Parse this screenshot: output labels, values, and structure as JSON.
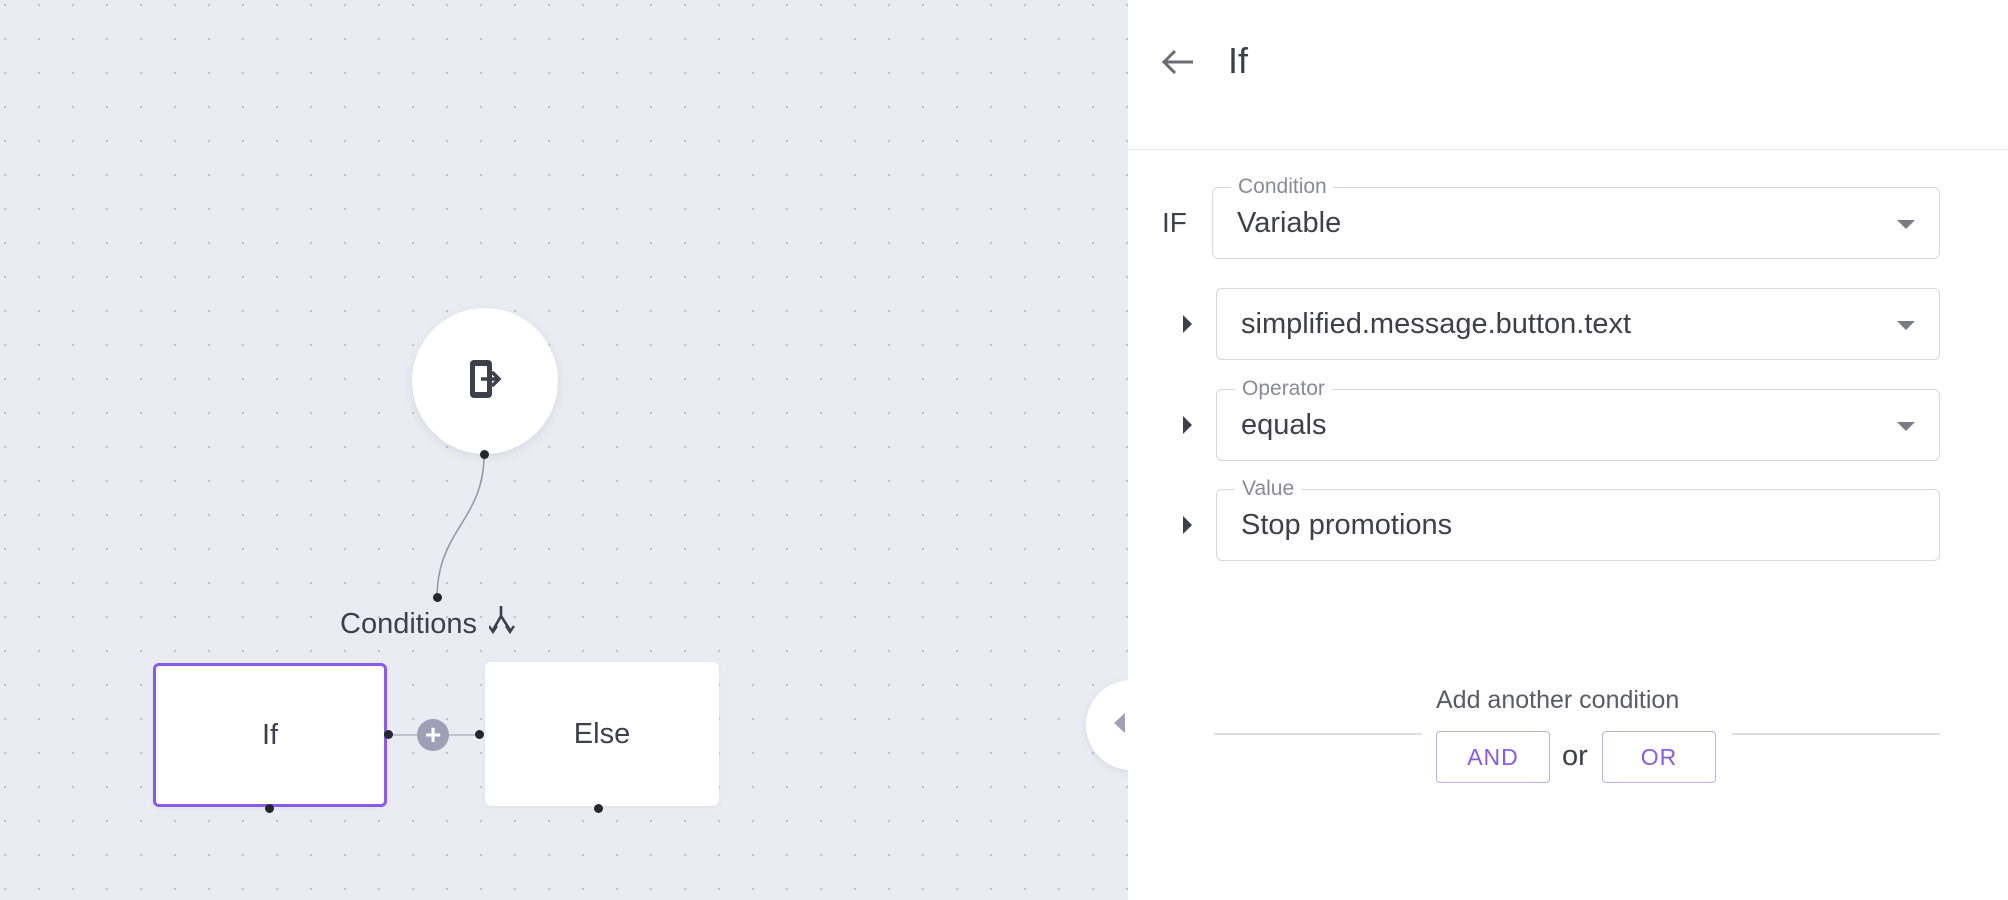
{
  "canvas": {
    "start_node_icon": "exit-app-icon",
    "group_title": "Conditions",
    "group_icon": "split-arrows-icon",
    "nodes": [
      {
        "label": "If",
        "selected": true
      },
      {
        "label": "Else",
        "selected": false
      }
    ],
    "add_button_label": "+",
    "panel_toggle_icon": "collapse-expand-icon"
  },
  "panel": {
    "title": "If",
    "back_icon": "arrow-left-icon",
    "if_label": "IF",
    "condition": {
      "label": "Condition",
      "value": "Variable"
    },
    "variable": {
      "value": "simplified.message.button.text"
    },
    "operator": {
      "label": "Operator",
      "value": "equals"
    },
    "value_field": {
      "label": "Value",
      "value": "Stop promotions"
    },
    "add_condition": {
      "label": "Add another condition",
      "and_label": "AND",
      "or_text": "or",
      "or_label": "OR"
    }
  },
  "colors": {
    "accent": "#8a5ae8",
    "canvas_bg": "#ebebf3",
    "text": "#3f3f4a"
  }
}
